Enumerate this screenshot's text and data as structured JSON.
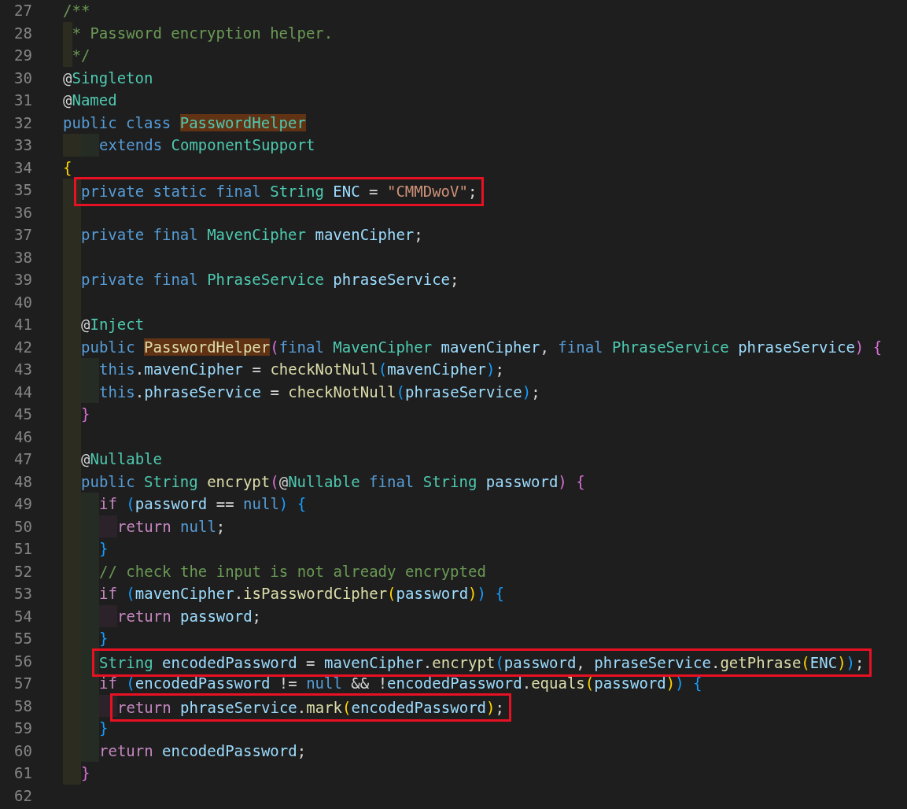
{
  "editor": {
    "lines": [
      {
        "number": "27",
        "boxed": false,
        "tokens": [
          {
            "kind": "cmt",
            "text": "/**"
          }
        ]
      },
      {
        "number": "28",
        "boxed": false,
        "guides": [
          {
            "kind": "narrow"
          }
        ],
        "tokens": [
          {
            "kind": "cmt",
            "text": "* Password encryption helper."
          }
        ]
      },
      {
        "number": "29",
        "boxed": false,
        "guides": [
          {
            "kind": "narrow"
          }
        ],
        "tokens": [
          {
            "kind": "cmt",
            "text": "*/"
          }
        ]
      },
      {
        "number": "30",
        "boxed": false,
        "tokens": [
          {
            "kind": "plain",
            "text": "@"
          },
          {
            "kind": "type",
            "text": "Singleton"
          }
        ]
      },
      {
        "number": "31",
        "boxed": false,
        "tokens": [
          {
            "kind": "plain",
            "text": "@"
          },
          {
            "kind": "type",
            "text": "Named"
          }
        ]
      },
      {
        "number": "32",
        "boxed": false,
        "tokens": [
          {
            "kind": "kw",
            "text": "public class "
          },
          {
            "kind": "type-match",
            "text": "PasswordHelper"
          }
        ]
      },
      {
        "number": "33",
        "boxed": false,
        "guides": [
          {
            "kind": "wide"
          },
          {
            "kind": "wide"
          }
        ],
        "tokens": [
          {
            "kind": "kw",
            "text": "extends "
          },
          {
            "kind": "type",
            "text": "ComponentSupport"
          }
        ]
      },
      {
        "number": "34",
        "boxed": false,
        "tokens": [
          {
            "kind": "b1",
            "text": "{"
          }
        ]
      },
      {
        "number": "35",
        "boxed": true,
        "guides": [
          {
            "kind": "wide"
          }
        ],
        "tokens": [
          {
            "kind": "kw",
            "text": "private static final "
          },
          {
            "kind": "type",
            "text": "String "
          },
          {
            "kind": "const",
            "text": "ENC"
          },
          {
            "kind": "plain",
            "text": " = "
          },
          {
            "kind": "str",
            "text": "\"CMMDwoV\""
          },
          {
            "kind": "plain",
            "text": ";"
          }
        ]
      },
      {
        "number": "36",
        "boxed": false,
        "guides": [
          {
            "kind": "wide"
          }
        ]
      },
      {
        "number": "37",
        "boxed": false,
        "guides": [
          {
            "kind": "wide"
          }
        ],
        "tokens": [
          {
            "kind": "kw",
            "text": "private final "
          },
          {
            "kind": "type",
            "text": "MavenCipher "
          },
          {
            "kind": "var",
            "text": "mavenCipher"
          },
          {
            "kind": "plain",
            "text": ";"
          }
        ]
      },
      {
        "number": "38",
        "boxed": false,
        "guides": [
          {
            "kind": "wide"
          }
        ]
      },
      {
        "number": "39",
        "boxed": false,
        "guides": [
          {
            "kind": "wide"
          }
        ],
        "tokens": [
          {
            "kind": "kw",
            "text": "private final "
          },
          {
            "kind": "type",
            "text": "PhraseService "
          },
          {
            "kind": "var",
            "text": "phraseService"
          },
          {
            "kind": "plain",
            "text": ";"
          }
        ]
      },
      {
        "number": "40",
        "boxed": false,
        "guides": [
          {
            "kind": "wide"
          }
        ]
      },
      {
        "number": "41",
        "boxed": false,
        "guides": [
          {
            "kind": "wide"
          }
        ],
        "tokens": [
          {
            "kind": "plain",
            "text": "@"
          },
          {
            "kind": "type",
            "text": "Inject"
          }
        ]
      },
      {
        "number": "42",
        "boxed": false,
        "guides": [
          {
            "kind": "wide"
          }
        ],
        "tokens": [
          {
            "kind": "kw",
            "text": "public "
          },
          {
            "kind": "fn-match",
            "text": "PasswordHelper"
          },
          {
            "kind": "b2",
            "text": "("
          },
          {
            "kind": "kw",
            "text": "final "
          },
          {
            "kind": "type",
            "text": "MavenCipher "
          },
          {
            "kind": "var",
            "text": "mavenCipher"
          },
          {
            "kind": "plain",
            "text": ", "
          },
          {
            "kind": "kw",
            "text": "final "
          },
          {
            "kind": "type",
            "text": "PhraseService "
          },
          {
            "kind": "var",
            "text": "phraseService"
          },
          {
            "kind": "b2",
            "text": ")"
          },
          {
            "kind": "b2",
            "text": " {"
          }
        ]
      },
      {
        "number": "43",
        "boxed": false,
        "guides": [
          {
            "kind": "wide"
          },
          {
            "kind": "wide"
          }
        ],
        "tokens": [
          {
            "kind": "kw",
            "text": "this"
          },
          {
            "kind": "plain",
            "text": "."
          },
          {
            "kind": "var",
            "text": "mavenCipher"
          },
          {
            "kind": "plain",
            "text": " = "
          },
          {
            "kind": "fn",
            "text": "checkNotNull"
          },
          {
            "kind": "b3",
            "text": "("
          },
          {
            "kind": "var",
            "text": "mavenCipher"
          },
          {
            "kind": "b3",
            "text": ")"
          },
          {
            "kind": "plain",
            "text": ";"
          }
        ]
      },
      {
        "number": "44",
        "boxed": false,
        "guides": [
          {
            "kind": "wide"
          },
          {
            "kind": "wide"
          }
        ],
        "tokens": [
          {
            "kind": "kw",
            "text": "this"
          },
          {
            "kind": "plain",
            "text": "."
          },
          {
            "kind": "var",
            "text": "phraseService"
          },
          {
            "kind": "plain",
            "text": " = "
          },
          {
            "kind": "fn",
            "text": "checkNotNull"
          },
          {
            "kind": "b3",
            "text": "("
          },
          {
            "kind": "var",
            "text": "phraseService"
          },
          {
            "kind": "b3",
            "text": ")"
          },
          {
            "kind": "plain",
            "text": ";"
          }
        ]
      },
      {
        "number": "45",
        "boxed": false,
        "guides": [
          {
            "kind": "wide"
          }
        ],
        "tokens": [
          {
            "kind": "b2",
            "text": "}"
          }
        ]
      },
      {
        "number": "46",
        "boxed": false,
        "guides": [
          {
            "kind": "wide"
          }
        ]
      },
      {
        "number": "47",
        "boxed": false,
        "guides": [
          {
            "kind": "wide"
          }
        ],
        "tokens": [
          {
            "kind": "plain",
            "text": "@"
          },
          {
            "kind": "type",
            "text": "Nullable"
          }
        ]
      },
      {
        "number": "48",
        "boxed": false,
        "guides": [
          {
            "kind": "wide"
          }
        ],
        "tokens": [
          {
            "kind": "kw",
            "text": "public "
          },
          {
            "kind": "type",
            "text": "String "
          },
          {
            "kind": "fn",
            "text": "encrypt"
          },
          {
            "kind": "b2",
            "text": "("
          },
          {
            "kind": "plain",
            "text": "@"
          },
          {
            "kind": "type",
            "text": "Nullable "
          },
          {
            "kind": "kw",
            "text": "final "
          },
          {
            "kind": "type",
            "text": "String "
          },
          {
            "kind": "var",
            "text": "password"
          },
          {
            "kind": "b2",
            "text": ")"
          },
          {
            "kind": "b2",
            "text": " {"
          }
        ]
      },
      {
        "number": "49",
        "boxed": false,
        "guides": [
          {
            "kind": "wide"
          },
          {
            "kind": "wide"
          }
        ],
        "tokens": [
          {
            "kind": "ctl",
            "text": "if "
          },
          {
            "kind": "b3",
            "text": "("
          },
          {
            "kind": "var",
            "text": "password"
          },
          {
            "kind": "plain",
            "text": " == "
          },
          {
            "kind": "kw",
            "text": "null"
          },
          {
            "kind": "b3",
            "text": ")"
          },
          {
            "kind": "b3",
            "text": " {"
          }
        ]
      },
      {
        "number": "50",
        "boxed": false,
        "guides": [
          {
            "kind": "wide"
          },
          {
            "kind": "wide"
          },
          {
            "kind": "wide"
          }
        ],
        "tokens": [
          {
            "kind": "ctl",
            "text": "return "
          },
          {
            "kind": "kw",
            "text": "null"
          },
          {
            "kind": "plain",
            "text": ";"
          }
        ]
      },
      {
        "number": "51",
        "boxed": false,
        "guides": [
          {
            "kind": "wide"
          },
          {
            "kind": "wide"
          }
        ],
        "tokens": [
          {
            "kind": "b3",
            "text": "}"
          }
        ]
      },
      {
        "number": "52",
        "boxed": false,
        "guides": [
          {
            "kind": "wide"
          },
          {
            "kind": "wide"
          }
        ],
        "tokens": [
          {
            "kind": "cmt",
            "text": "// check the input is not already encrypted"
          }
        ]
      },
      {
        "number": "53",
        "boxed": false,
        "guides": [
          {
            "kind": "wide"
          },
          {
            "kind": "wide"
          }
        ],
        "tokens": [
          {
            "kind": "ctl",
            "text": "if "
          },
          {
            "kind": "b3",
            "text": "("
          },
          {
            "kind": "var",
            "text": "mavenCipher"
          },
          {
            "kind": "plain",
            "text": "."
          },
          {
            "kind": "fn",
            "text": "isPasswordCipher"
          },
          {
            "kind": "b1",
            "text": "("
          },
          {
            "kind": "var",
            "text": "password"
          },
          {
            "kind": "b1",
            "text": ")"
          },
          {
            "kind": "b3",
            "text": ")"
          },
          {
            "kind": "b3",
            "text": " {"
          }
        ]
      },
      {
        "number": "54",
        "boxed": false,
        "guides": [
          {
            "kind": "wide"
          },
          {
            "kind": "wide"
          },
          {
            "kind": "wide"
          }
        ],
        "tokens": [
          {
            "kind": "ctl",
            "text": "return "
          },
          {
            "kind": "var",
            "text": "password"
          },
          {
            "kind": "plain",
            "text": ";"
          }
        ]
      },
      {
        "number": "55",
        "boxed": false,
        "guides": [
          {
            "kind": "wide"
          },
          {
            "kind": "wide"
          }
        ],
        "tokens": [
          {
            "kind": "b3",
            "text": "}"
          }
        ]
      },
      {
        "number": "56",
        "boxed": true,
        "guides": [
          {
            "kind": "wide"
          },
          {
            "kind": "wide"
          }
        ],
        "tokens": [
          {
            "kind": "type",
            "text": "String "
          },
          {
            "kind": "var",
            "text": "encodedPassword"
          },
          {
            "kind": "plain",
            "text": " = "
          },
          {
            "kind": "var",
            "text": "mavenCipher"
          },
          {
            "kind": "plain",
            "text": "."
          },
          {
            "kind": "fn",
            "text": "encrypt"
          },
          {
            "kind": "b3",
            "text": "("
          },
          {
            "kind": "var",
            "text": "password"
          },
          {
            "kind": "plain",
            "text": ", "
          },
          {
            "kind": "var",
            "text": "phraseService"
          },
          {
            "kind": "plain",
            "text": "."
          },
          {
            "kind": "fn",
            "text": "getPhrase"
          },
          {
            "kind": "b1",
            "text": "("
          },
          {
            "kind": "const",
            "text": "ENC"
          },
          {
            "kind": "b1",
            "text": ")"
          },
          {
            "kind": "b3",
            "text": ")"
          },
          {
            "kind": "plain",
            "text": ";"
          }
        ]
      },
      {
        "number": "57",
        "boxed": false,
        "guides": [
          {
            "kind": "wide"
          },
          {
            "kind": "wide"
          }
        ],
        "tokens": [
          {
            "kind": "ctl",
            "text": "if "
          },
          {
            "kind": "b3",
            "text": "("
          },
          {
            "kind": "var",
            "text": "encodedPassword"
          },
          {
            "kind": "plain",
            "text": " != "
          },
          {
            "kind": "kw",
            "text": "null"
          },
          {
            "kind": "plain",
            "text": " && !"
          },
          {
            "kind": "var",
            "text": "encodedPassword"
          },
          {
            "kind": "plain",
            "text": "."
          },
          {
            "kind": "fn",
            "text": "equals"
          },
          {
            "kind": "b1",
            "text": "("
          },
          {
            "kind": "var",
            "text": "password"
          },
          {
            "kind": "b1",
            "text": ")"
          },
          {
            "kind": "b3",
            "text": ")"
          },
          {
            "kind": "b3",
            "text": " {"
          }
        ]
      },
      {
        "number": "58",
        "boxed": true,
        "guides": [
          {
            "kind": "wide"
          },
          {
            "kind": "wide"
          },
          {
            "kind": "wide"
          }
        ],
        "tokens": [
          {
            "kind": "ctl",
            "text": "return "
          },
          {
            "kind": "var",
            "text": "phraseService"
          },
          {
            "kind": "plain",
            "text": "."
          },
          {
            "kind": "fn",
            "text": "mark"
          },
          {
            "kind": "b1",
            "text": "("
          },
          {
            "kind": "var",
            "text": "encodedPassword"
          },
          {
            "kind": "b1",
            "text": ")"
          },
          {
            "kind": "plain",
            "text": ";"
          }
        ]
      },
      {
        "number": "59",
        "boxed": false,
        "guides": [
          {
            "kind": "wide"
          },
          {
            "kind": "wide"
          }
        ],
        "tokens": [
          {
            "kind": "b3",
            "text": "}"
          }
        ]
      },
      {
        "number": "60",
        "boxed": false,
        "guides": [
          {
            "kind": "wide"
          },
          {
            "kind": "wide"
          }
        ],
        "tokens": [
          {
            "kind": "ctl",
            "text": "return "
          },
          {
            "kind": "var",
            "text": "encodedPassword"
          },
          {
            "kind": "plain",
            "text": ";"
          }
        ]
      },
      {
        "number": "61",
        "boxed": false,
        "guides": [
          {
            "kind": "wide"
          }
        ],
        "tokens": [
          {
            "kind": "b2",
            "text": "}"
          }
        ]
      },
      {
        "number": "62",
        "boxed": false
      }
    ]
  }
}
